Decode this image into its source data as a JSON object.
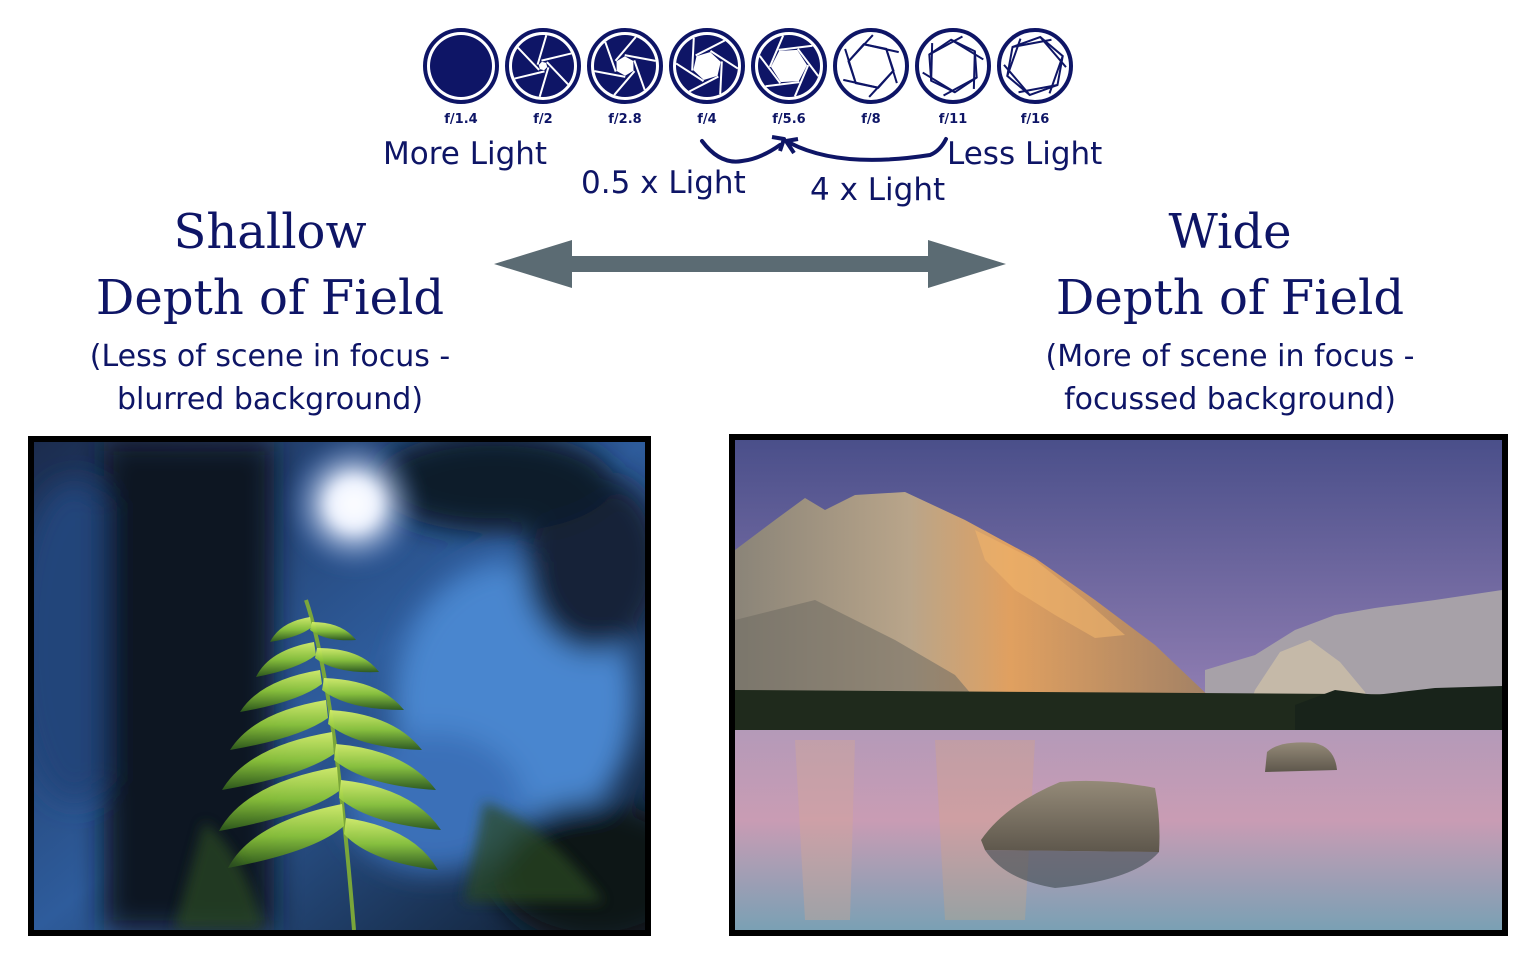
{
  "colors": {
    "primary": "#0e1566",
    "arrow": "#5b6b73",
    "frame": "#000000"
  },
  "aperture": {
    "stops": [
      {
        "label": "f/1.4",
        "openness": 0.0
      },
      {
        "label": "f/2",
        "openness": 0.18
      },
      {
        "label": "f/2.8",
        "openness": 0.35
      },
      {
        "label": "f/4",
        "openness": 0.5
      },
      {
        "label": "f/5.6",
        "openness": 0.62
      },
      {
        "label": "f/8",
        "openness": 0.74
      },
      {
        "label": "f/11",
        "openness": 0.85
      },
      {
        "label": "f/16",
        "openness": 0.95
      }
    ],
    "more_light": "More Light",
    "less_light": "Less Light",
    "half_light": "0.5 x Light",
    "four_light": "4 x Light"
  },
  "shallow": {
    "title_line1": "Shallow",
    "title_line2": "Depth of Field",
    "sub_line1": "(Less of scene in focus -",
    "sub_line2": "blurred background)"
  },
  "wide": {
    "title_line1": "Wide",
    "title_line2": "Depth of Field",
    "sub_line1": "(More of scene in focus -",
    "sub_line2": "focussed background)"
  },
  "icons": {
    "double_arrow": "double-arrow-icon",
    "aperture": "aperture-icon",
    "curved_arrow": "curved-arrow-icon"
  }
}
